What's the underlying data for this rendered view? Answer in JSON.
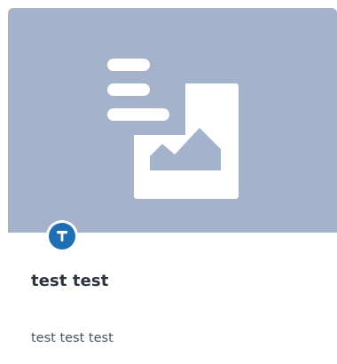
{
  "card": {
    "title": "test test",
    "description": "test test test",
    "image_placeholder_icon": "image-text-placeholder-icon",
    "category_icon": "pin-icon",
    "colors": {
      "image_background": "#a4b3cb",
      "badge": "#1f6fb2",
      "title": "#2c3440",
      "description": "#4a5360"
    }
  }
}
